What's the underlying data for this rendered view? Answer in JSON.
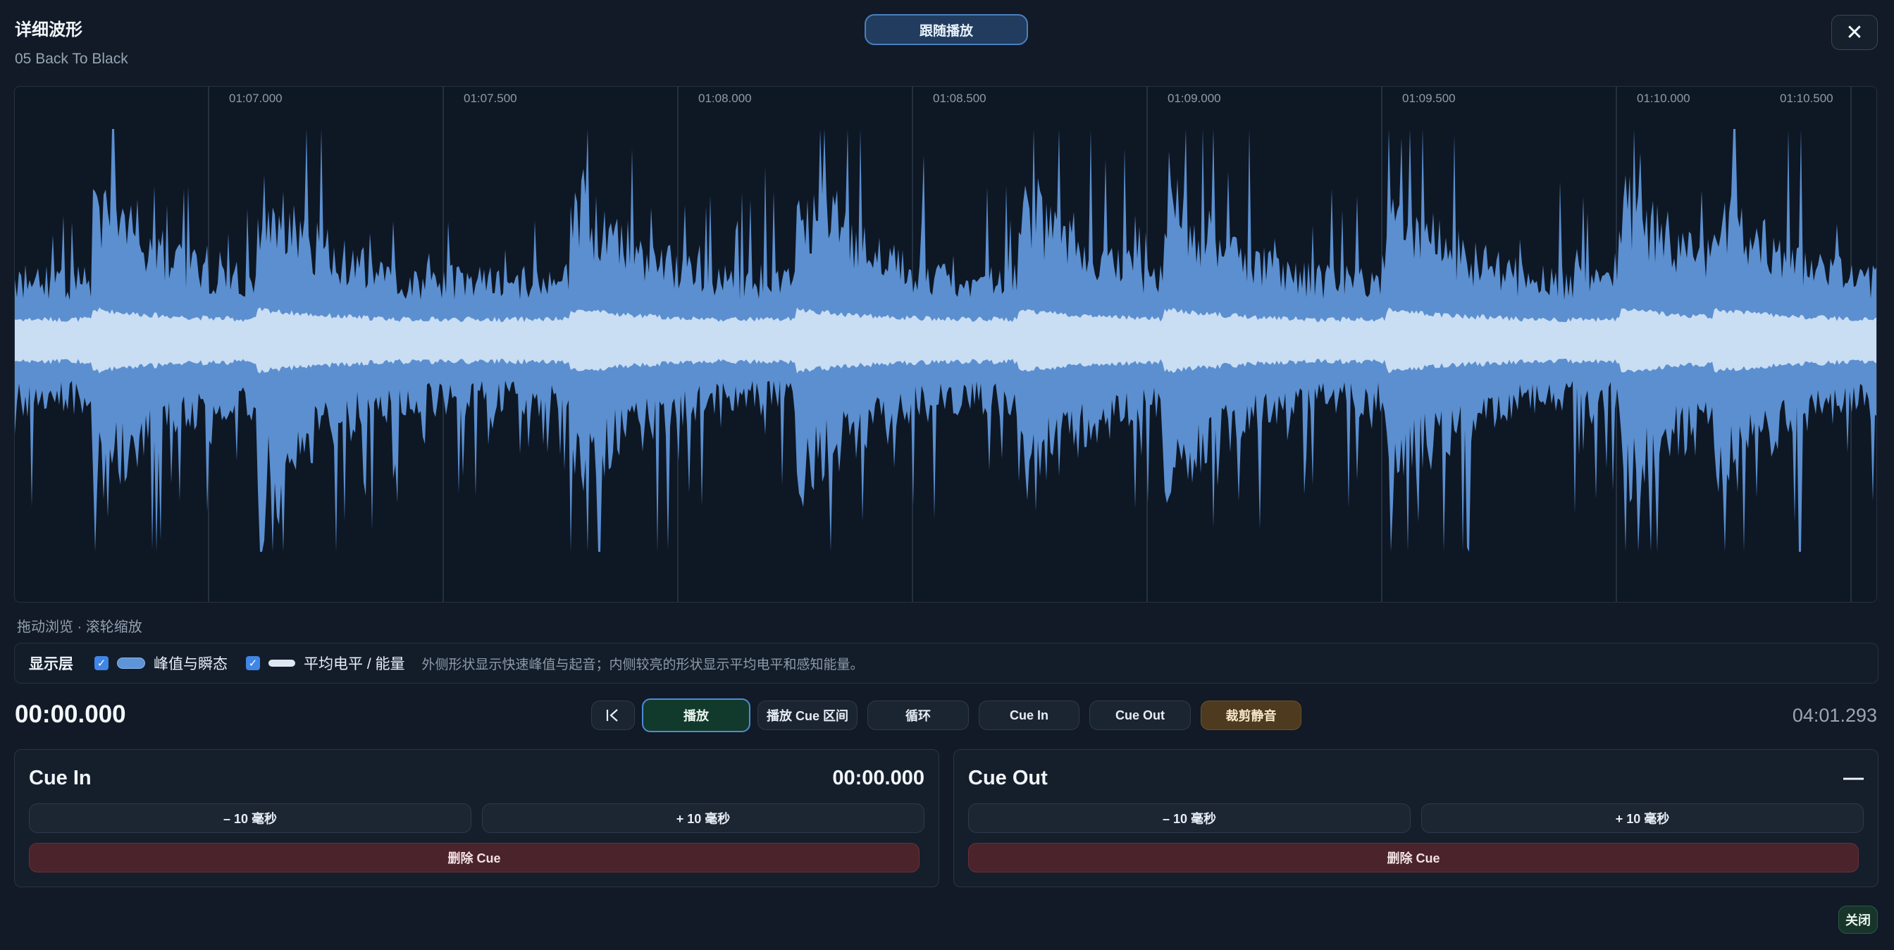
{
  "header": {
    "title": "详细波形",
    "track": "05 Back To Black",
    "follow_label": "跟随播放",
    "close_icon": "✕"
  },
  "waveform": {
    "ticks": [
      "01:07.000",
      "01:07.500",
      "01:08.000",
      "01:08.500",
      "01:09.000",
      "01:09.500",
      "01:10.000",
      "01:10.500"
    ],
    "colors": {
      "peak": "#5b8fd0",
      "avg": "#c9ddf3",
      "background": "#0e1724",
      "gridline": "#2b384a"
    }
  },
  "hint": "拖动浏览 · 滚轮缩放",
  "layers": {
    "title": "显示层",
    "peak_label": "峰值与瞬态",
    "avg_label": "平均电平 / 能量",
    "description": "外侧形状显示快速峰值与起音；内侧较亮的形状显示平均电平和感知能量。",
    "peak_checked": true,
    "avg_checked": true
  },
  "transport": {
    "current_time": "00:00.000",
    "total_time": "04:01.293",
    "to_start_icon": "|<",
    "play": "播放",
    "play_cue": "播放 Cue 区间",
    "loop": "循环",
    "cue_in": "Cue In",
    "cue_out": "Cue Out",
    "trim_silence": "裁剪静音"
  },
  "cue_in_panel": {
    "title": "Cue In",
    "value": "00:00.000",
    "minus": "– 10 毫秒",
    "plus": "+ 10 毫秒",
    "delete": "删除 Cue"
  },
  "cue_out_panel": {
    "title": "Cue Out",
    "value": "—",
    "minus": "– 10 毫秒",
    "plus": "+ 10 毫秒",
    "delete": "删除 Cue"
  },
  "footer": {
    "close": "关闭"
  }
}
